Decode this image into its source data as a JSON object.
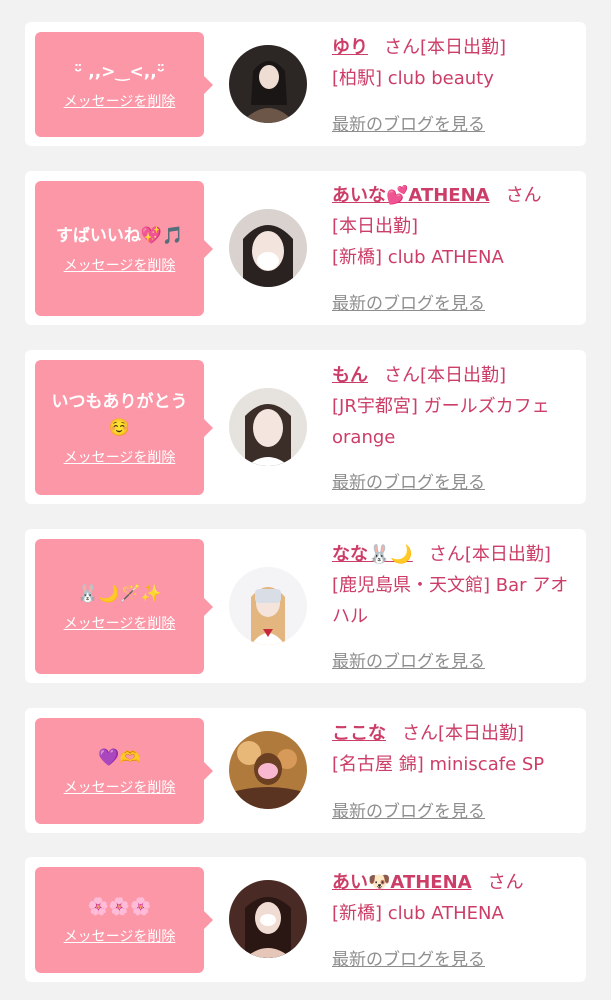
{
  "colors": {
    "page_background": "#f2f2f2",
    "card_background": "#ffffff",
    "bubble_pink": "#fc97a7",
    "name_pink": "#cc3d67",
    "link_gray": "#8e8e8e"
  },
  "delete_label": "メッセージを削除",
  "san_label": "さん",
  "blog_label": "最新のブログを見る",
  "cards": [
    {
      "message": "ᵕ̈ ,,>‿<,,ᵕ̈",
      "name": "ゆり",
      "attendance": "[本日出勤]",
      "shop": "[柏駅] club beauty",
      "avatar_icon": "avatar-photo"
    },
    {
      "message": "すばいいね💖🎵",
      "name": "あいな💕ATHENA",
      "attendance": "[本日出勤]",
      "shop": "[新橋] club ATHENA",
      "avatar_icon": "avatar-photo"
    },
    {
      "message": "いつもありがとう☺️",
      "name": "もん",
      "attendance": "[本日出勤]",
      "shop": "[JR宇都宮] ガールズカフェ orange",
      "avatar_icon": "avatar-photo"
    },
    {
      "message": "🐰🌙🪄✨",
      "name": "なな🐰🌙",
      "attendance": "[本日出勤]",
      "shop": "[鹿児島県・天文館] Bar アオハル",
      "avatar_icon": "avatar-photo"
    },
    {
      "message": "💜🫶",
      "name": "ここな",
      "attendance": "[本日出勤]",
      "shop": "[名古屋 錦] miniscafe SP",
      "avatar_icon": "avatar-photo"
    },
    {
      "message": "🌸🌸🌸",
      "name": "あい🐶ATHENA",
      "attendance": "",
      "shop": "[新橋] club ATHENA",
      "avatar_icon": "avatar-photo"
    }
  ]
}
